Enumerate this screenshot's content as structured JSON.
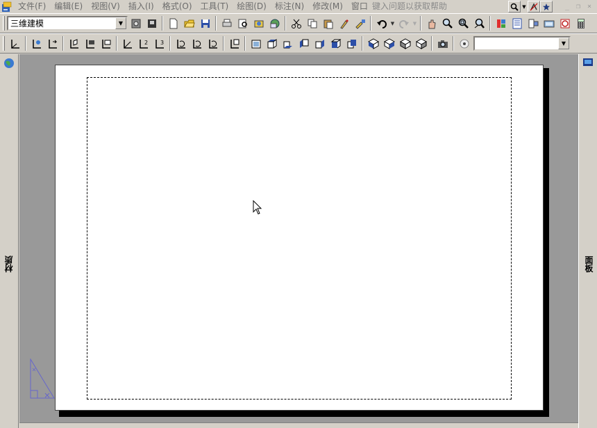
{
  "menubar": {
    "items": [
      {
        "label": "文件(F)"
      },
      {
        "label": "编辑(E)"
      },
      {
        "label": "视图(V)"
      },
      {
        "label": "插入(I)"
      },
      {
        "label": "格式(O)"
      },
      {
        "label": "工具(T)"
      },
      {
        "label": "绘图(D)"
      },
      {
        "label": "标注(N)"
      },
      {
        "label": "修改(M)"
      },
      {
        "label": "窗口"
      }
    ],
    "help_placeholder": "键入问题以获取帮助",
    "window_controls": [
      "_",
      "❐",
      "×"
    ]
  },
  "toolbar1": {
    "workspace": "三维建模",
    "buttons": [
      "workspace-settings",
      "save-workspace",
      "new",
      "open",
      "save",
      "plot",
      "plot-preview",
      "publish",
      "3d-dwf",
      "cut",
      "copy",
      "paste",
      "match-properties",
      "block-editor",
      "undo",
      "redo",
      "pan",
      "zoom-realtime",
      "zoom-window",
      "zoom-previous",
      "tool-palettes",
      "properties",
      "design-center",
      "sheet-set-manager",
      "markup-set-manager",
      "quickcalc"
    ]
  },
  "toolbar2": {
    "buttons": [
      "ucs",
      "world-ucs",
      "ucs-previous",
      "face-ucs",
      "object-ucs",
      "view-ucs",
      "origin-ucs",
      "z-axis-ucs",
      "3point-ucs",
      "x-ucs",
      "y-ucs",
      "z-ucs",
      "apply-ucs",
      "named-views",
      "top-view",
      "bottom-view",
      "left-view",
      "right-view",
      "front-view",
      "back-view",
      "sw-iso",
      "se-iso",
      "ne-iso",
      "nw-iso",
      "camera",
      "named-ucs"
    ],
    "layer_value": ""
  },
  "side_left": {
    "label": "材质"
  },
  "side_right": {
    "label": "面板"
  },
  "colors": {
    "canvas": "#999999",
    "paper": "#ffffff",
    "chrome": "#d4d0c8"
  }
}
